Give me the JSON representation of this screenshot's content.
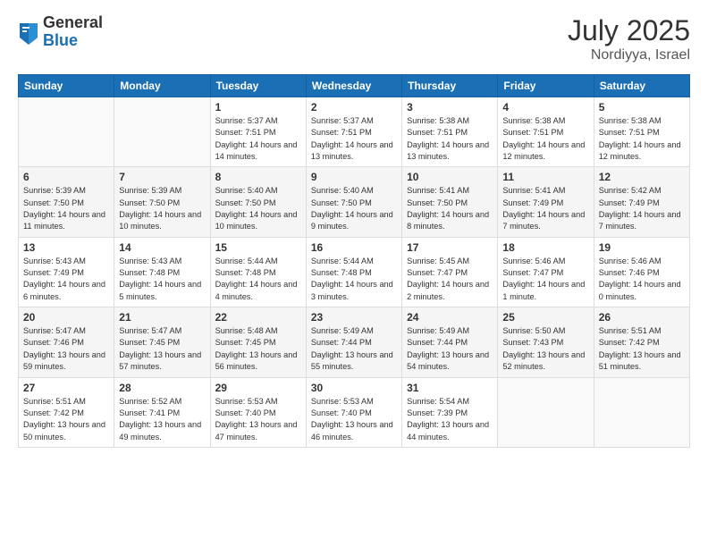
{
  "logo": {
    "general": "General",
    "blue": "Blue"
  },
  "title": {
    "month": "July 2025",
    "location": "Nordiyya, Israel"
  },
  "days_of_week": [
    "Sunday",
    "Monday",
    "Tuesday",
    "Wednesday",
    "Thursday",
    "Friday",
    "Saturday"
  ],
  "weeks": [
    [
      {
        "day": "",
        "info": ""
      },
      {
        "day": "",
        "info": ""
      },
      {
        "day": "1",
        "info": "Sunrise: 5:37 AM\nSunset: 7:51 PM\nDaylight: 14 hours and 14 minutes."
      },
      {
        "day": "2",
        "info": "Sunrise: 5:37 AM\nSunset: 7:51 PM\nDaylight: 14 hours and 13 minutes."
      },
      {
        "day": "3",
        "info": "Sunrise: 5:38 AM\nSunset: 7:51 PM\nDaylight: 14 hours and 13 minutes."
      },
      {
        "day": "4",
        "info": "Sunrise: 5:38 AM\nSunset: 7:51 PM\nDaylight: 14 hours and 12 minutes."
      },
      {
        "day": "5",
        "info": "Sunrise: 5:38 AM\nSunset: 7:51 PM\nDaylight: 14 hours and 12 minutes."
      }
    ],
    [
      {
        "day": "6",
        "info": "Sunrise: 5:39 AM\nSunset: 7:50 PM\nDaylight: 14 hours and 11 minutes."
      },
      {
        "day": "7",
        "info": "Sunrise: 5:39 AM\nSunset: 7:50 PM\nDaylight: 14 hours and 10 minutes."
      },
      {
        "day": "8",
        "info": "Sunrise: 5:40 AM\nSunset: 7:50 PM\nDaylight: 14 hours and 10 minutes."
      },
      {
        "day": "9",
        "info": "Sunrise: 5:40 AM\nSunset: 7:50 PM\nDaylight: 14 hours and 9 minutes."
      },
      {
        "day": "10",
        "info": "Sunrise: 5:41 AM\nSunset: 7:50 PM\nDaylight: 14 hours and 8 minutes."
      },
      {
        "day": "11",
        "info": "Sunrise: 5:41 AM\nSunset: 7:49 PM\nDaylight: 14 hours and 7 minutes."
      },
      {
        "day": "12",
        "info": "Sunrise: 5:42 AM\nSunset: 7:49 PM\nDaylight: 14 hours and 7 minutes."
      }
    ],
    [
      {
        "day": "13",
        "info": "Sunrise: 5:43 AM\nSunset: 7:49 PM\nDaylight: 14 hours and 6 minutes."
      },
      {
        "day": "14",
        "info": "Sunrise: 5:43 AM\nSunset: 7:48 PM\nDaylight: 14 hours and 5 minutes."
      },
      {
        "day": "15",
        "info": "Sunrise: 5:44 AM\nSunset: 7:48 PM\nDaylight: 14 hours and 4 minutes."
      },
      {
        "day": "16",
        "info": "Sunrise: 5:44 AM\nSunset: 7:48 PM\nDaylight: 14 hours and 3 minutes."
      },
      {
        "day": "17",
        "info": "Sunrise: 5:45 AM\nSunset: 7:47 PM\nDaylight: 14 hours and 2 minutes."
      },
      {
        "day": "18",
        "info": "Sunrise: 5:46 AM\nSunset: 7:47 PM\nDaylight: 14 hours and 1 minute."
      },
      {
        "day": "19",
        "info": "Sunrise: 5:46 AM\nSunset: 7:46 PM\nDaylight: 14 hours and 0 minutes."
      }
    ],
    [
      {
        "day": "20",
        "info": "Sunrise: 5:47 AM\nSunset: 7:46 PM\nDaylight: 13 hours and 59 minutes."
      },
      {
        "day": "21",
        "info": "Sunrise: 5:47 AM\nSunset: 7:45 PM\nDaylight: 13 hours and 57 minutes."
      },
      {
        "day": "22",
        "info": "Sunrise: 5:48 AM\nSunset: 7:45 PM\nDaylight: 13 hours and 56 minutes."
      },
      {
        "day": "23",
        "info": "Sunrise: 5:49 AM\nSunset: 7:44 PM\nDaylight: 13 hours and 55 minutes."
      },
      {
        "day": "24",
        "info": "Sunrise: 5:49 AM\nSunset: 7:44 PM\nDaylight: 13 hours and 54 minutes."
      },
      {
        "day": "25",
        "info": "Sunrise: 5:50 AM\nSunset: 7:43 PM\nDaylight: 13 hours and 52 minutes."
      },
      {
        "day": "26",
        "info": "Sunrise: 5:51 AM\nSunset: 7:42 PM\nDaylight: 13 hours and 51 minutes."
      }
    ],
    [
      {
        "day": "27",
        "info": "Sunrise: 5:51 AM\nSunset: 7:42 PM\nDaylight: 13 hours and 50 minutes."
      },
      {
        "day": "28",
        "info": "Sunrise: 5:52 AM\nSunset: 7:41 PM\nDaylight: 13 hours and 49 minutes."
      },
      {
        "day": "29",
        "info": "Sunrise: 5:53 AM\nSunset: 7:40 PM\nDaylight: 13 hours and 47 minutes."
      },
      {
        "day": "30",
        "info": "Sunrise: 5:53 AM\nSunset: 7:40 PM\nDaylight: 13 hours and 46 minutes."
      },
      {
        "day": "31",
        "info": "Sunrise: 5:54 AM\nSunset: 7:39 PM\nDaylight: 13 hours and 44 minutes."
      },
      {
        "day": "",
        "info": ""
      },
      {
        "day": "",
        "info": ""
      }
    ]
  ]
}
